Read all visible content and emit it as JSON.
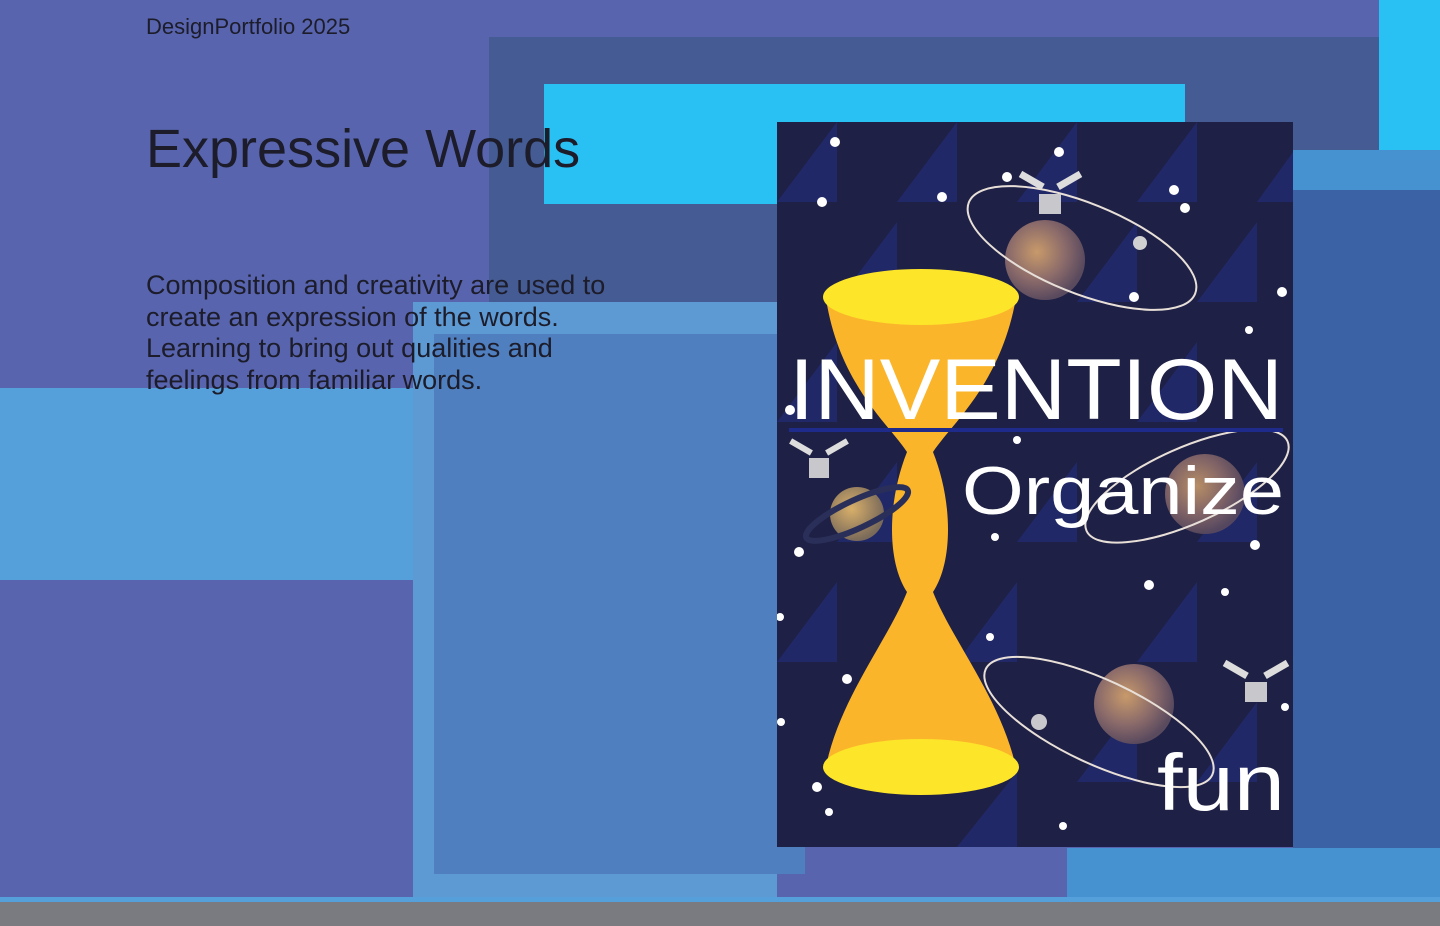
{
  "header": {
    "brand": "DesignPortfolio 2025"
  },
  "main": {
    "title": "Expressive Words",
    "description": "Composition and creativity are used to create an expression of the words. Learning to bring out qualities and feelings from familiar words."
  },
  "poster": {
    "words": [
      "INVENTION",
      "Organize",
      "fun"
    ],
    "icons": [
      "hourglass-icon",
      "satellite-icon",
      "planet-icon",
      "ringed-planet-icon",
      "star-icon"
    ]
  },
  "colors": {
    "page_background": "#5865ae",
    "dark_panel": "#455b93",
    "cyan": "#29c1f3",
    "light_blue": "#55a0da",
    "mid_blue": "#4f7fbe",
    "poster_background": "#1e2045",
    "hourglass_orange": "#fbb52a",
    "hourglass_yellow": "#fde52a",
    "footer_gray": "#7a7b80"
  }
}
